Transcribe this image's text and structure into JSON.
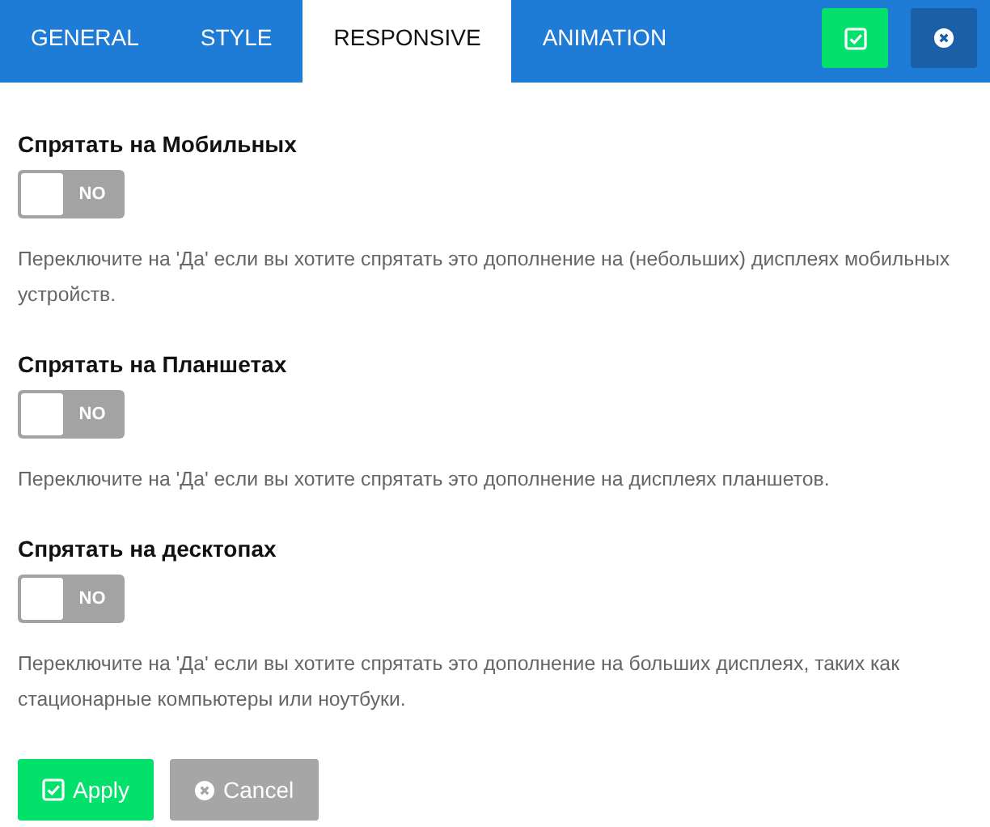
{
  "tabs": [
    {
      "label": "GENERAL",
      "selected": false
    },
    {
      "label": "STYLE",
      "selected": false
    },
    {
      "label": "RESPONSIVE",
      "selected": true
    },
    {
      "label": "ANIMATION",
      "selected": false
    }
  ],
  "header_buttons": [
    {
      "kind": "save"
    },
    {
      "kind": "close"
    }
  ],
  "settings": [
    {
      "title": "Спрятать на Мобильных",
      "toggle": {
        "on": false,
        "label": "NO"
      },
      "description": "Переключите на 'Да' если вы хотите спрятать это дополнение на (небольших) дисплеях мобильных устройств."
    },
    {
      "title": "Спрятать на Планшетах",
      "toggle": {
        "on": false,
        "label": "NO"
      },
      "description": "Переключите на 'Да' если вы хотите спрятать это дополнение на дисплеях планшетов."
    },
    {
      "title": "Спрятать на десктопах",
      "toggle": {
        "on": false,
        "label": "NO"
      },
      "description": "Переключите на 'Да' если вы хотите спрятать это дополнение на больших дисплеях, таких как стационарные компьютеры или ноутбуки."
    }
  ],
  "buttons": [
    {
      "kind": "apply",
      "label": "Apply"
    },
    {
      "kind": "cancel",
      "label": "Cancel"
    }
  ]
}
